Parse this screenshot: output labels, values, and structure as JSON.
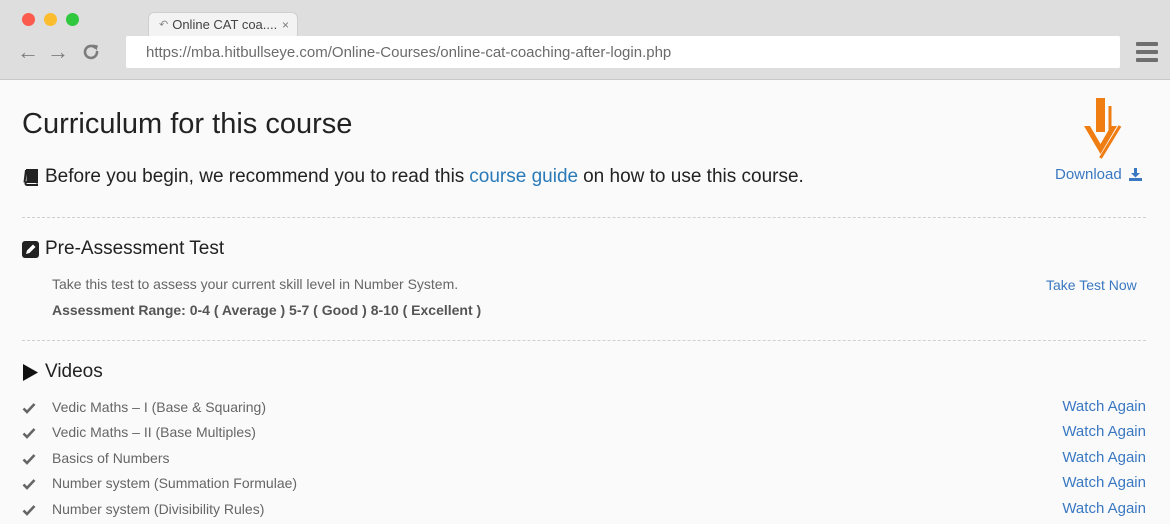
{
  "browser": {
    "tab_title": "Online CAT coa....",
    "tab_close": "×",
    "url": "https://mba.hitbullseye.com/Online-Courses/online-cat-coaching-after-login.php"
  },
  "page": {
    "title": "Curriculum for this course",
    "intro_before": "Before you begin, we recommend you to read this",
    "intro_link": "course guide",
    "intro_after": "on how to use this course.",
    "download_label": "Download"
  },
  "pre_assessment": {
    "heading": "Pre-Assessment Test",
    "description": "Take this test to assess your current skill level in Number System.",
    "range": "Assessment Range: 0-4 ( Average ) 5-7 ( Good ) 8-10 ( Excellent )",
    "action": "Take Test Now"
  },
  "videos": {
    "heading": "Videos",
    "items": [
      {
        "title": "Vedic Maths – I (Base & Squaring)",
        "action": "Watch Again"
      },
      {
        "title": "Vedic Maths – II (Base Multiples)",
        "action": "Watch Again"
      },
      {
        "title": "Basics of Numbers",
        "action": "Watch Again"
      },
      {
        "title": "Number system (Summation Formulae)",
        "action": "Watch Again"
      },
      {
        "title": "Number system (Divisibility Rules)",
        "action": "Watch Again"
      }
    ]
  },
  "colors": {
    "link": "#2a7ab8",
    "action": "#3a78c2",
    "arrow": "#f07d12"
  }
}
